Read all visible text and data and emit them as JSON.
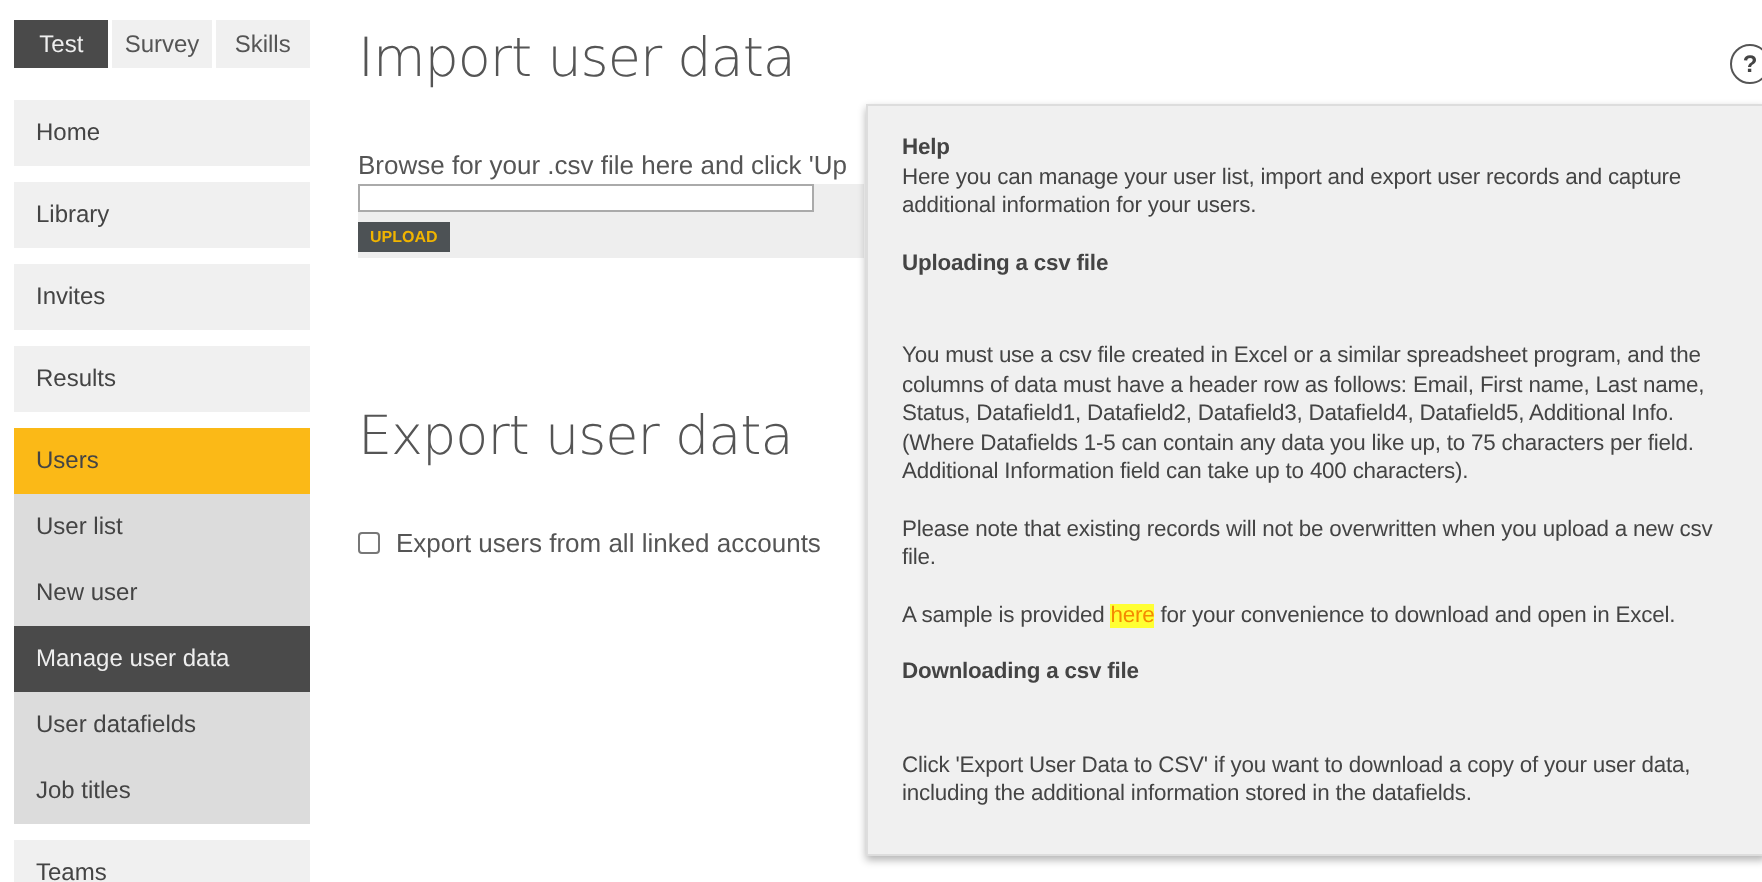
{
  "tabs": [
    {
      "label": "Test",
      "selected": true
    },
    {
      "label": "Survey",
      "selected": false
    },
    {
      "label": "Skills",
      "selected": false
    }
  ],
  "sidebar": {
    "items": [
      {
        "label": "Home",
        "expanded": false
      },
      {
        "label": "Library",
        "expanded": false
      },
      {
        "label": "Invites",
        "expanded": false
      },
      {
        "label": "Results",
        "expanded": false
      },
      {
        "label": "Users",
        "expanded": true,
        "children": [
          {
            "label": "User list",
            "selected": false
          },
          {
            "label": "New user",
            "selected": false
          },
          {
            "label": "Manage user data",
            "selected": true
          },
          {
            "label": "User datafields",
            "selected": false
          },
          {
            "label": "Job titles",
            "selected": false
          }
        ]
      },
      {
        "label": "Teams",
        "expanded": false
      }
    ]
  },
  "import": {
    "title": "Import user data",
    "instruction": "Browse for your .csv file here and click 'Up",
    "upload_button": "UPLOAD"
  },
  "export": {
    "title": "Export user data",
    "checkbox": {
      "label": "Export users from all linked accounts",
      "checked": false
    }
  },
  "help_button": "?",
  "help": {
    "title": "Help",
    "intro": "Here you can manage your user list, import and export user records and capture additional information for your users.",
    "sections": [
      {
        "heading": "Uploading a csv file",
        "paragraphs": [
          {
            "text": "You must use a csv file created in Excel or a similar spreadsheet program, and the columns of data must have a header row as follows: Email, First name, Last name, Status, Datafield1, Datafield2, Datafield3, Datafield4, Datafield5, Additional Info. (Where Datafields 1-5 can contain any data you like up, to 75 characters per field. Additional Information field can take up to 400 characters)."
          },
          {
            "text": "Please note that existing records will not be overwritten when you upload a new csv file."
          },
          {
            "text": "A sample is provided ",
            "link": "here",
            "after": " for your convenience to download and open in Excel."
          }
        ]
      },
      {
        "heading": "Downloading a csv file",
        "paragraphs": [
          {
            "text": "Click 'Export User Data to CSV' if you want to download a copy of your user data, including the additional information stored in the datafields."
          }
        ]
      }
    ]
  }
}
